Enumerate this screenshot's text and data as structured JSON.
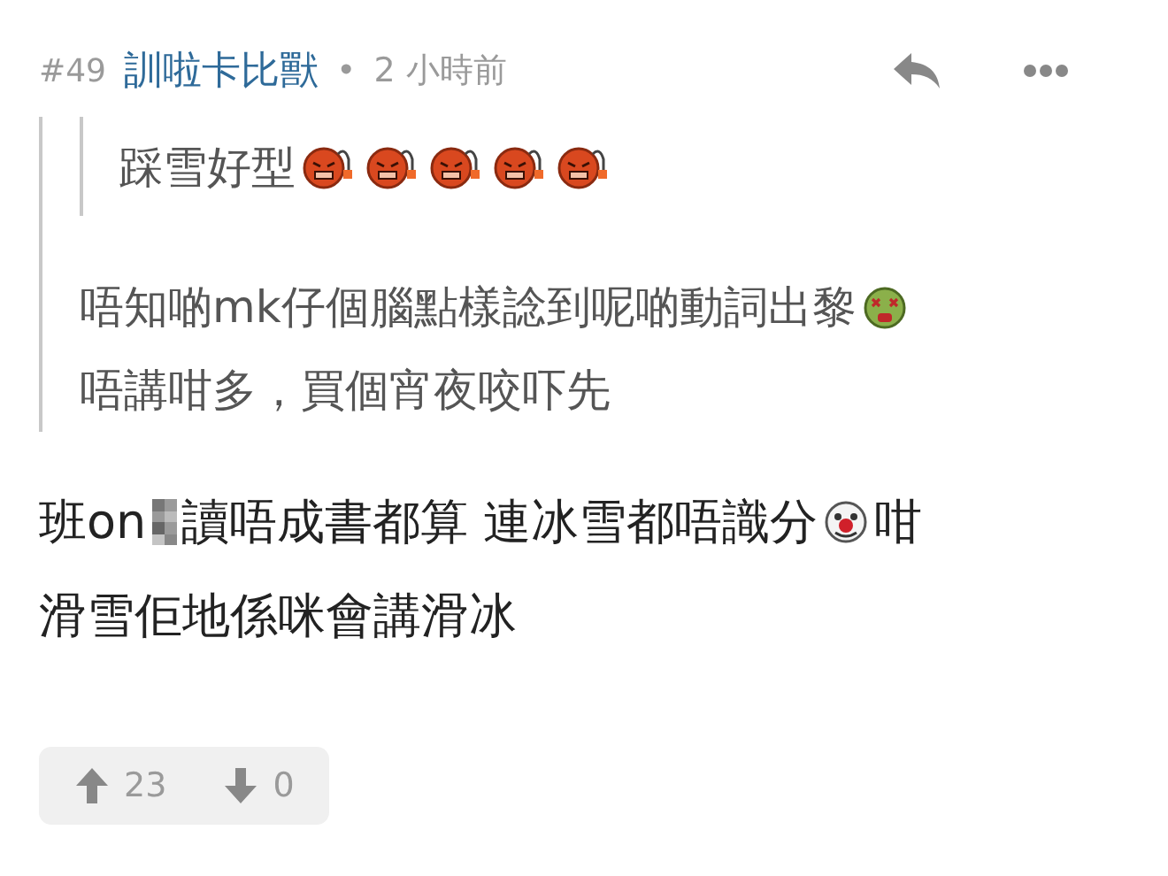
{
  "post": {
    "number": "#49",
    "username": "訓啦卡比獸",
    "separator": "•",
    "time": "2 小時前",
    "quote": {
      "quote": {
        "lines": [
          [
            {
              "kind": "text",
              "text": "踩雪好型"
            },
            {
              "kind": "angry"
            },
            {
              "kind": "angry"
            },
            {
              "kind": "angry"
            },
            {
              "kind": "angry"
            },
            {
              "kind": "angry"
            }
          ]
        ]
      },
      "lines": [
        [
          {
            "kind": "text",
            "text": "唔知啲mk仔個腦點樣諗到呢啲動詞出黎"
          },
          {
            "kind": "sick"
          }
        ],
        [
          {
            "kind": "text",
            "text": "唔講咁多，買個宵夜咬吓先"
          }
        ]
      ]
    },
    "body": [
      [
        {
          "kind": "text",
          "text": "班on"
        },
        {
          "kind": "censored"
        },
        {
          "kind": "text",
          "text": "讀唔成書都算 連冰雪都唔識分"
        },
        {
          "kind": "clown"
        },
        {
          "kind": "text",
          "text": " 咁"
        }
      ],
      [
        {
          "kind": "text",
          "text": "滑雪佢地係咪會講滑冰"
        }
      ]
    ],
    "votes": {
      "up": "23",
      "down": "0"
    }
  }
}
